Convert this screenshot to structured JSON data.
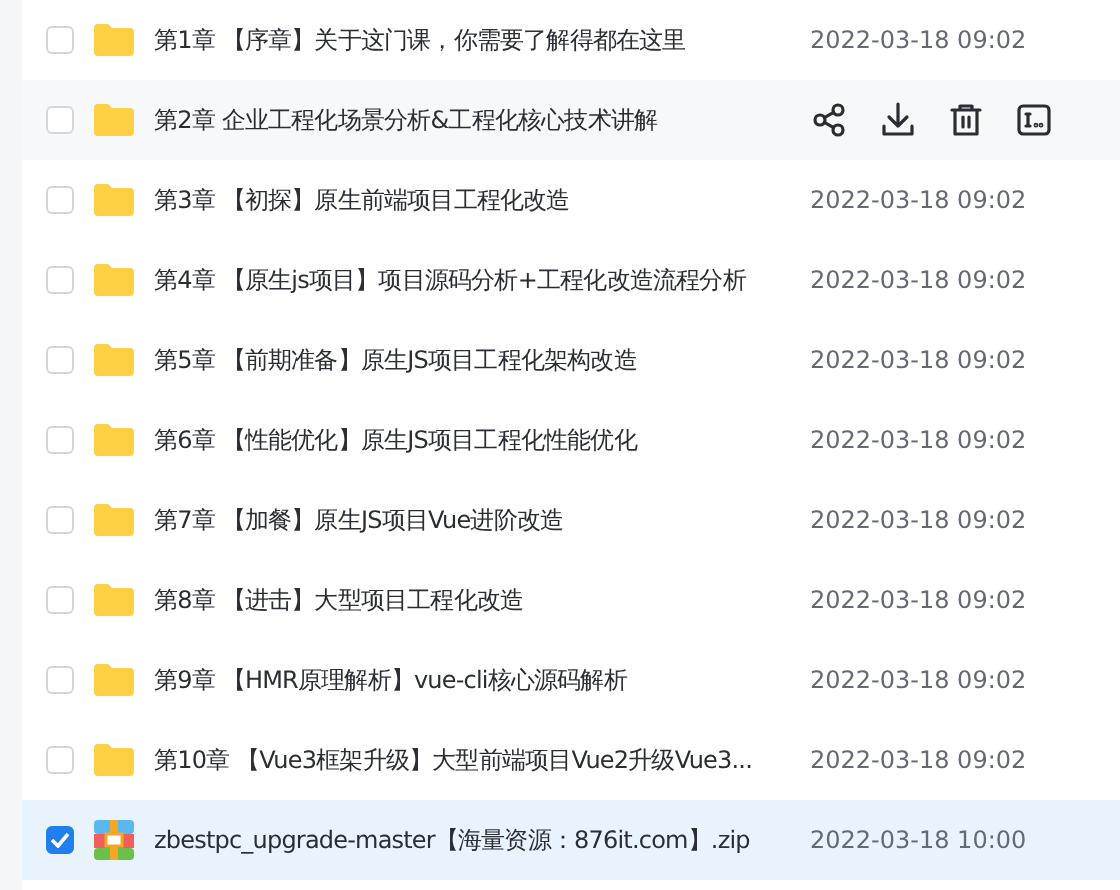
{
  "rows": [
    {
      "kind": "folder",
      "name": "第1章 【序章】关于这门课，你需要了解得都在这里",
      "date": "2022-03-18 09:02",
      "selected": false,
      "hovered": false
    },
    {
      "kind": "folder",
      "name": "第2章 企业工程化场景分析&工程化核心技术讲解",
      "selected": false,
      "hovered": true
    },
    {
      "kind": "folder",
      "name": "第3章 【初探】原生前端项目工程化改造",
      "date": "2022-03-18 09:02",
      "selected": false,
      "hovered": false
    },
    {
      "kind": "folder",
      "name": "第4章 【原生js项目】项目源码分析+工程化改造流程分析",
      "date": "2022-03-18 09:02",
      "selected": false,
      "hovered": false
    },
    {
      "kind": "folder",
      "name": "第5章 【前期准备】原生JS项目工程化架构改造",
      "date": "2022-03-18 09:02",
      "selected": false,
      "hovered": false
    },
    {
      "kind": "folder",
      "name": "第6章 【性能优化】原生JS项目工程化性能优化",
      "date": "2022-03-18 09:02",
      "selected": false,
      "hovered": false
    },
    {
      "kind": "folder",
      "name": "第7章 【加餐】原生JS项目Vue进阶改造",
      "date": "2022-03-18 09:02",
      "selected": false,
      "hovered": false
    },
    {
      "kind": "folder",
      "name": "第8章 【进击】大型项目工程化改造",
      "date": "2022-03-18 09:02",
      "selected": false,
      "hovered": false
    },
    {
      "kind": "folder",
      "name": "第9章 【HMR原理解析】vue-cli核心源码解析",
      "date": "2022-03-18 09:02",
      "selected": false,
      "hovered": false
    },
    {
      "kind": "folder",
      "name": "第10章 【Vue3框架升级】大型前端项目Vue2升级Vue3...",
      "date": "2022-03-18 09:02",
      "selected": false,
      "hovered": false
    },
    {
      "kind": "archive",
      "name": "zbestpc_upgrade-master【海量资源：876it.com】.zip",
      "date": "2022-03-18 10:00",
      "selected": true,
      "hovered": false
    }
  ]
}
